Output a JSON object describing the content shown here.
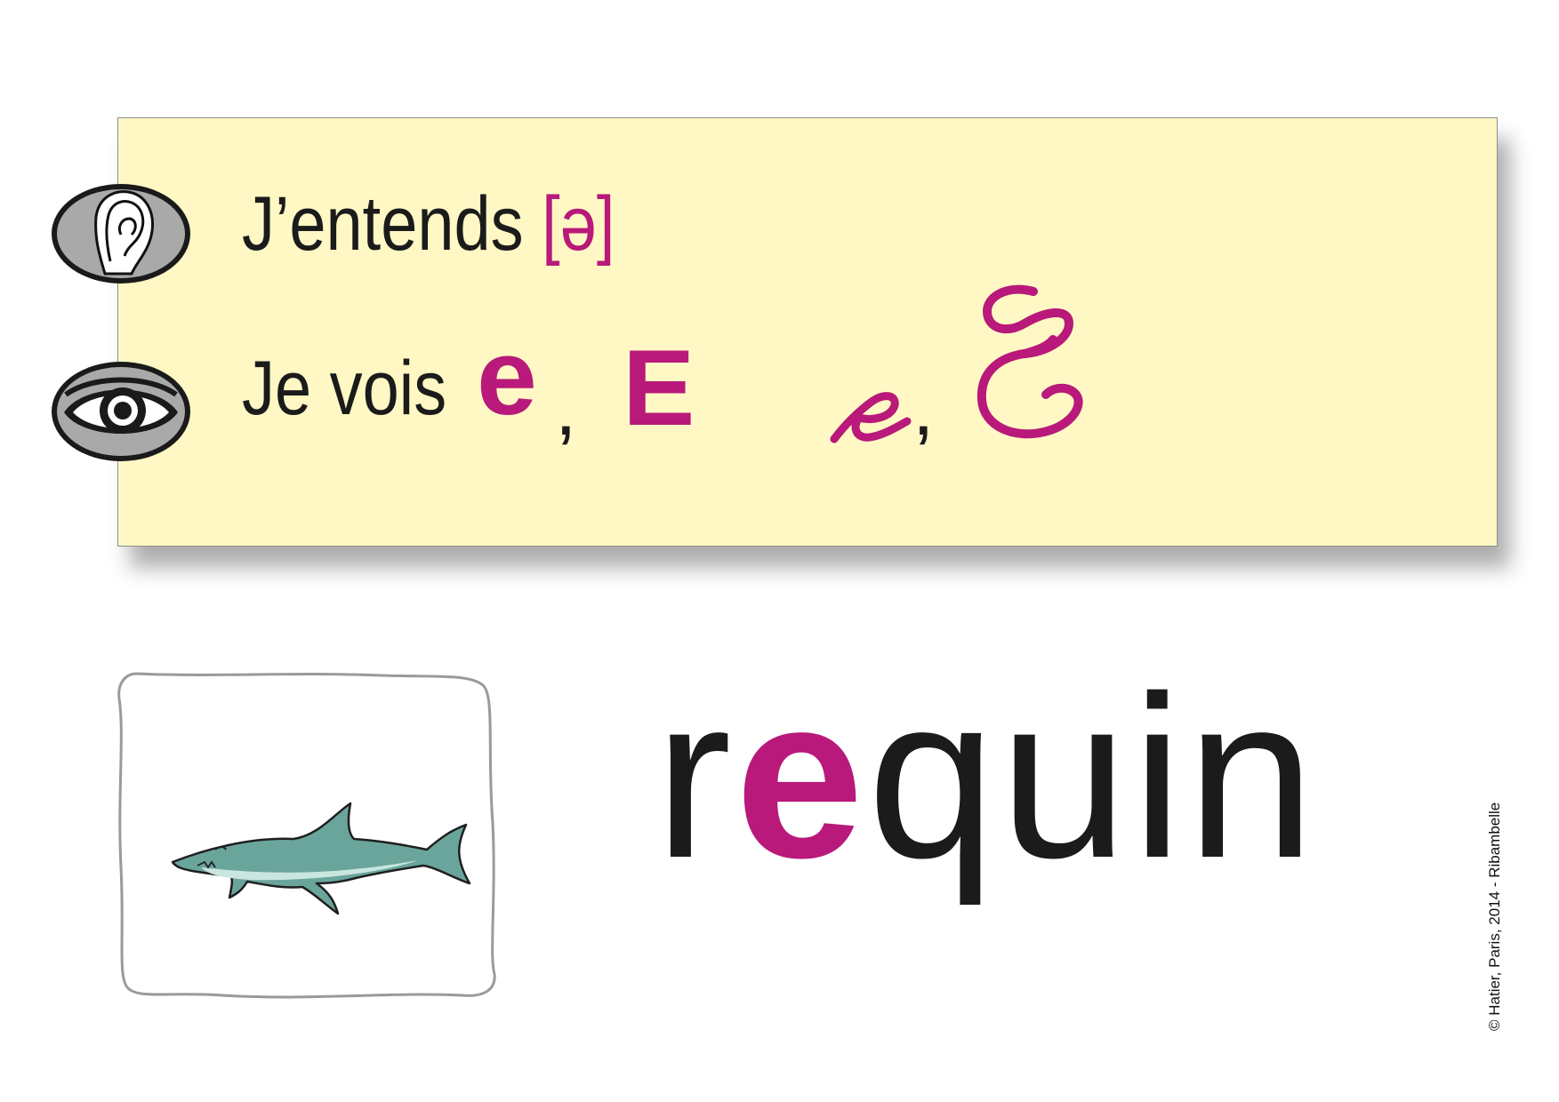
{
  "banner": {
    "hear_text": "J’entends ",
    "phoneme": "[ə]",
    "see_text": "Je vois ",
    "letters": {
      "print_lower": "e",
      "print_upper": "E",
      "comma": ",",
      "cursive_lower": "e",
      "cursive_upper": "E"
    },
    "icons": [
      "ear-icon",
      "eye-icon"
    ]
  },
  "picture": {
    "subject_icon": "shark-icon"
  },
  "word": {
    "prefix": "r",
    "highlight": "e",
    "suffix": "quin"
  },
  "copyright": "© Hatier, Paris, 2014 - Ribambelle",
  "colors": {
    "accent": "#b8197a",
    "banner_bg": "#fff8c4",
    "text": "#1b1b1b"
  }
}
